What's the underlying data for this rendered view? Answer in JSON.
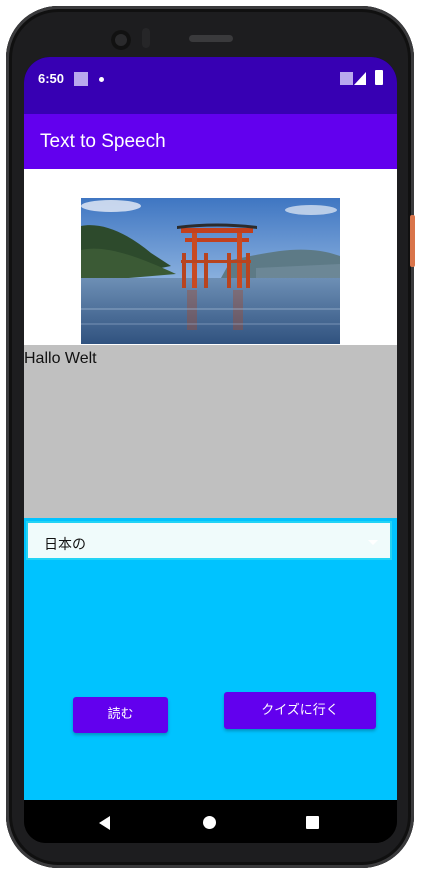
{
  "status_bar": {
    "time": "6:50"
  },
  "toolbar": {
    "title": "Text to Speech"
  },
  "main": {
    "output_text": "Hallo Welt",
    "spinner": {
      "selected": "日本の"
    },
    "read_button_label": "読む",
    "quiz_button_label": "クイズに行く"
  },
  "icons": {
    "back": "back-icon",
    "home": "home-icon",
    "recent": "recent-apps-icon"
  },
  "colors": {
    "status_bar": "#3700b3",
    "toolbar": "#6200ee",
    "primary_button": "#6200ee",
    "text_area": "#c0c0c0",
    "lower_area": "#00c3ff"
  }
}
